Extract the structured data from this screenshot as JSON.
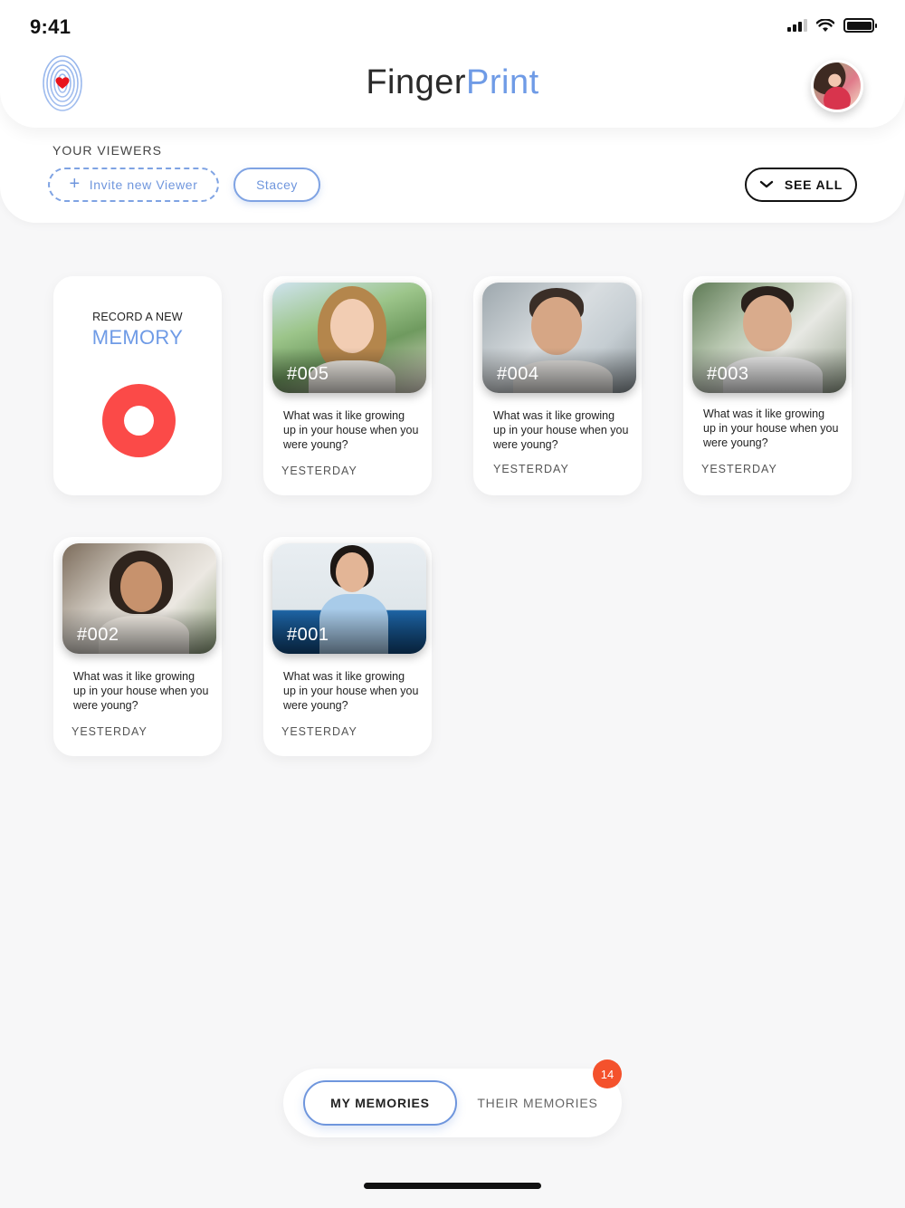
{
  "status_bar": {
    "time": "9:41"
  },
  "header": {
    "title_part1": "Finger",
    "title_part2": "Print",
    "brand_color": "#6f9be6",
    "logo_icon": "fingerprint-heart-icon"
  },
  "viewers": {
    "label": "YOUR VIEWERS",
    "invite_label": "Invite new Viewer",
    "chips": [
      "Stacey"
    ],
    "see_all_label": "SEE ALL"
  },
  "record_card": {
    "kicker": "RECORD A NEW",
    "title": "MEMORY",
    "button_color": "#fb4a48"
  },
  "memories": [
    {
      "id": "#005",
      "question": "What was it like growing up in your house when you were young?",
      "date": "YESTERDAY"
    },
    {
      "id": "#004",
      "question": "What was it like growing up in your house when you were young?",
      "date": "YESTERDAY"
    },
    {
      "id": "#003",
      "question": "What was it like growing up in your house when you were young?",
      "date": "YESTERDAY"
    },
    {
      "id": "#002",
      "question": "What was it like growing up in your house when you were young?",
      "date": "YESTERDAY"
    },
    {
      "id": "#001",
      "question": "What was it like growing up in your house when you were young?",
      "date": "YESTERDAY"
    }
  ],
  "tabs": {
    "active_label": "MY MEMORIES",
    "inactive_label": "THEIR MEMORIES",
    "badge_count": "14",
    "badge_color": "#f4512c"
  }
}
